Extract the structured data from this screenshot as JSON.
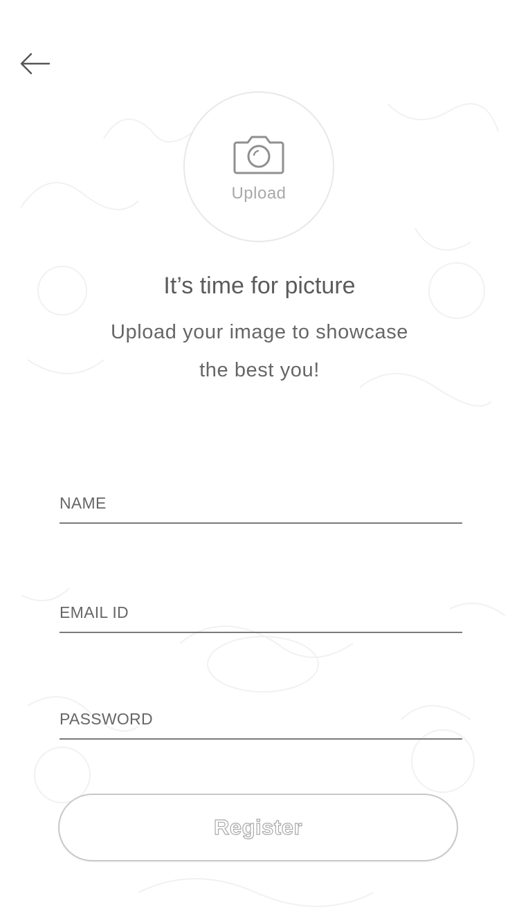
{
  "header": {
    "back_icon": "arrow-left-icon"
  },
  "upload": {
    "icon": "camera-icon",
    "label": "Upload"
  },
  "intro": {
    "title": "It’s time for picture",
    "subtitle_line1": "Upload your image to showcase",
    "subtitle_line2": "the best you!"
  },
  "form": {
    "name_placeholder": "NAME",
    "name_value": "",
    "email_placeholder": "EMAIL ID",
    "email_value": "",
    "password_placeholder": "PASSWORD",
    "password_value": "",
    "register_label": "Register"
  },
  "colors": {
    "background": "#ffffff",
    "text": "#555555",
    "muted": "#a9a9a9",
    "underline": "#7a7a7a",
    "button_border": "#c8c8c8"
  }
}
